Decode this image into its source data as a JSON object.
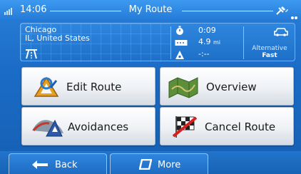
{
  "status": {
    "time": "14:06",
    "title": "My Route"
  },
  "info": {
    "destination_line1": "Chicago",
    "destination_line2": "IL, United States",
    "duration": "0:09",
    "distance_value": "4.9",
    "distance_unit": "mi",
    "arrival": "-:--",
    "route_type_label": "Alternative",
    "route_type_value": "Fast"
  },
  "actions": {
    "edit_route": "Edit Route",
    "overview": "Overview",
    "avoidances": "Avoidances",
    "cancel_route": "Cancel Route"
  },
  "bottom": {
    "back": "Back",
    "more": "More"
  }
}
